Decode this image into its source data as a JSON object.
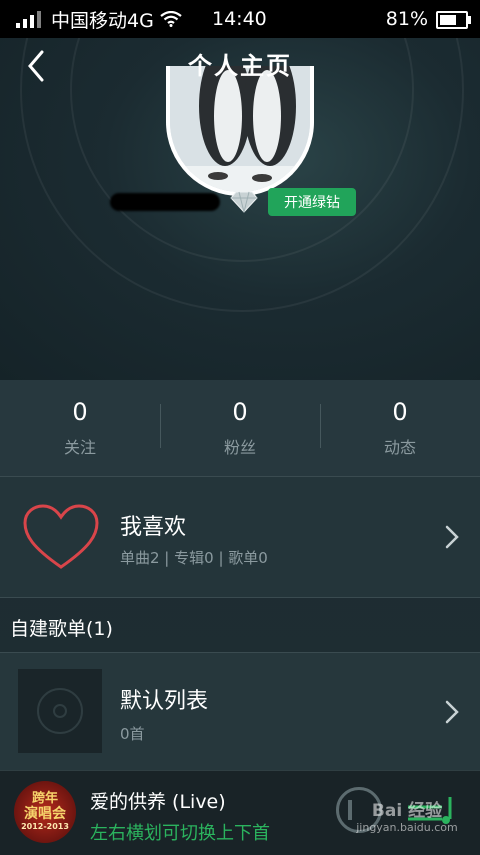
{
  "status_bar": {
    "carrier": "中国移动4G",
    "time": "14:40",
    "battery": "81%",
    "battery_level": 0.81
  },
  "header": {
    "title": "个人主页"
  },
  "profile": {
    "vip_button_label": "开通绿钻"
  },
  "stats": [
    {
      "value": "0",
      "label": "关注"
    },
    {
      "value": "0",
      "label": "粉丝"
    },
    {
      "value": "0",
      "label": "动态"
    }
  ],
  "favorites": {
    "title": "我喜欢",
    "meta": "单曲2 | 专辑0 | 歌单0"
  },
  "playlists_section": {
    "title": "自建歌单(1)",
    "items": [
      {
        "title": "默认列表",
        "meta": "0首"
      }
    ]
  },
  "player": {
    "song_title": "爱的供养 (Live)",
    "hint": "左右横划可切换上下首",
    "album_badge": [
      "跨年",
      "演唱会",
      "2012-2013"
    ]
  },
  "watermark": {
    "brand": "Bai 经验",
    "url": "jingyan.baidu.com"
  },
  "colors": {
    "accent_green": "#21a45a",
    "hint_green": "#2bb35e",
    "heart_red": "#d9454a"
  }
}
